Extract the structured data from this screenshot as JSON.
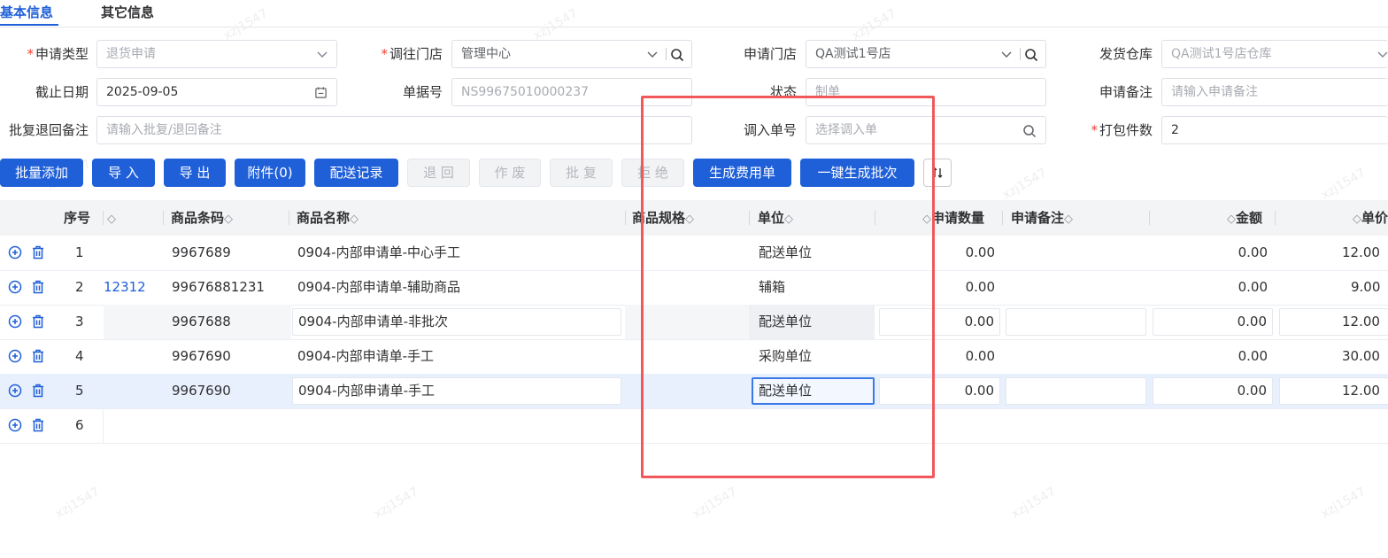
{
  "tabs": [
    {
      "label": "基本信息",
      "active": true
    },
    {
      "label": "其它信息",
      "active": false
    }
  ],
  "form": {
    "apply_type": {
      "label": "申请类型",
      "required": true,
      "value": "退货申请"
    },
    "transfer_store": {
      "label": "调往门店",
      "required": true,
      "value": "管理中心"
    },
    "apply_store": {
      "label": "申请门店",
      "required": false,
      "value": "QA测试1号店"
    },
    "ship_warehouse": {
      "label": "发货仓库",
      "required": false,
      "value": "QA测试1号店仓库"
    },
    "deadline": {
      "label": "截止日期",
      "required": false,
      "value": "2025-09-05"
    },
    "doc_no": {
      "label": "单据号",
      "required": false,
      "value": "NS99675010000237"
    },
    "status": {
      "label": "状态",
      "required": false,
      "value": "制单"
    },
    "apply_remark": {
      "label": "申请备注",
      "required": false,
      "placeholder": "请输入申请备注"
    },
    "reply_remark": {
      "label": "批复退回备注",
      "required": false,
      "placeholder": "请输入批复/退回备注"
    },
    "transfer_in_no": {
      "label": "调入单号",
      "required": false,
      "placeholder": "选择调入单"
    },
    "pack_count": {
      "label": "打包件数",
      "required": true,
      "value": "2"
    }
  },
  "toolbar": {
    "batch_add": "批量添加",
    "import": "导 入",
    "export": "导 出",
    "attachment": "附件(0)",
    "delivery_record": "配送记录",
    "return": "退 回",
    "void": "作 废",
    "approve": "批 复",
    "reject": "拒 绝",
    "gen_fee": "生成费用单",
    "gen_batch": "一键生成批次"
  },
  "table": {
    "headers": {
      "seq": "序号",
      "code": "商品条码",
      "name": "商品名称",
      "spec": "商品规格",
      "unit": "单位",
      "qty": "申请数量",
      "remark": "申请备注",
      "amount": "金额",
      "price": "单价"
    },
    "rows": [
      {
        "seq": "1",
        "extra": "",
        "code": "9967689",
        "name": "0904-内部申请单-中心手工",
        "unit": "配送单位",
        "qty": "0.00",
        "amount": "0.00",
        "price": "12.00"
      },
      {
        "seq": "2",
        "extra": "12312",
        "code": "99676881231",
        "name": "0904-内部申请单-辅助商品",
        "unit": "辅箱",
        "qty": "0.00",
        "amount": "0.00",
        "price": "9.00"
      },
      {
        "seq": "3",
        "extra": "",
        "code": "9967688",
        "name": "0904-内部申请单-非批次",
        "unit": "配送单位",
        "qty": "0.00",
        "amount": "0.00",
        "price": "12.00"
      },
      {
        "seq": "4",
        "extra": "",
        "code": "9967690",
        "name": "0904-内部申请单-手工",
        "unit": "采购单位",
        "qty": "0.00",
        "amount": "0.00",
        "price": "30.00"
      },
      {
        "seq": "5",
        "extra": "",
        "code": "9967690",
        "name": "0904-内部申请单-手工",
        "unit": "配送单位",
        "qty": "0.00",
        "amount": "0.00",
        "price": "12.00"
      },
      {
        "seq": "6",
        "extra": "",
        "code": "",
        "name": "",
        "unit": "",
        "qty": "",
        "amount": "",
        "price": ""
      }
    ]
  },
  "watermark": "xzj1547",
  "colors": {
    "primary": "#1f5fd8",
    "highlight_box": "#f2575a",
    "required": "#f04134"
  }
}
